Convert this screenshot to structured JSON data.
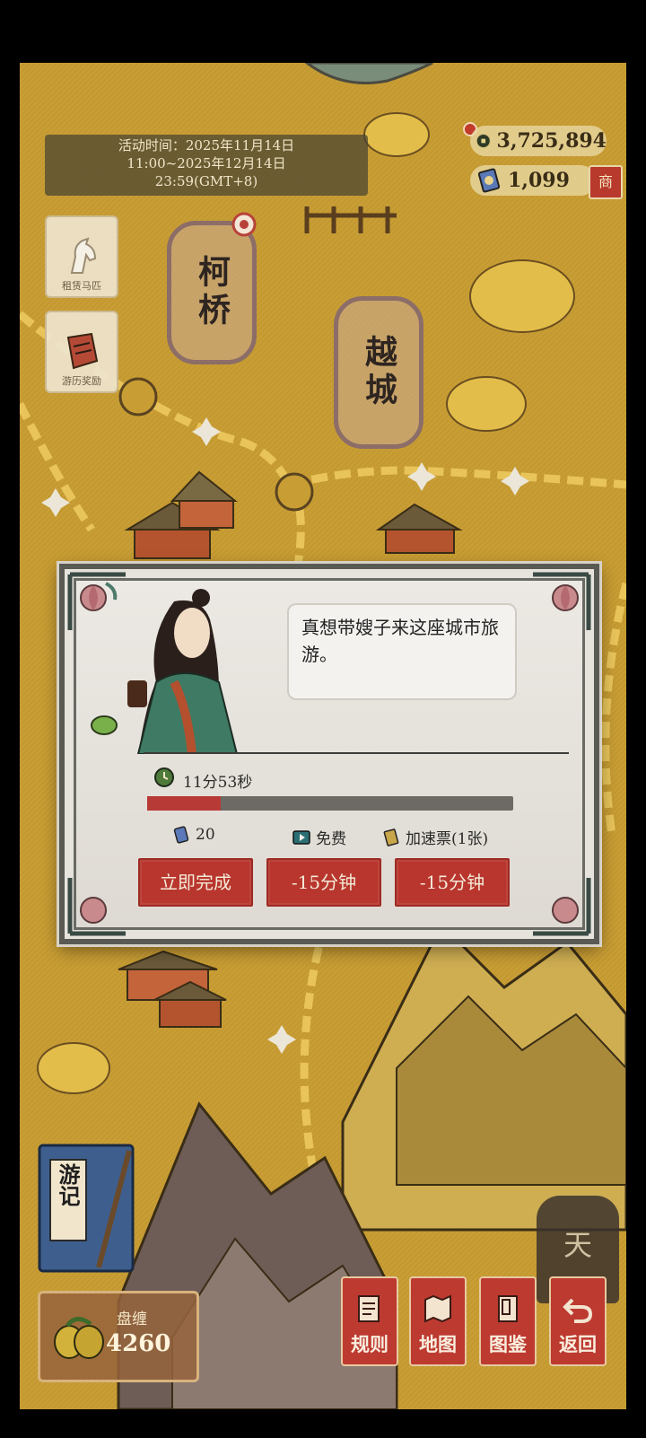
{
  "event": {
    "line1": "活动时间：2025年11月14日",
    "line2": "11:00~2025年12月14日",
    "line3": "23:59(GMT+8)"
  },
  "currency": {
    "coins": "3,725,894",
    "tickets": "1,099",
    "coin_icon": "copper-coin-icon",
    "ticket_icon": "ticket-icon",
    "shop_label": "商"
  },
  "side_buttons": [
    {
      "label": "租赁马匹",
      "icon": "horse-icon"
    },
    {
      "label": "游历奖励",
      "icon": "reward-scroll-icon"
    }
  ],
  "cities": [
    {
      "name": "柯桥"
    },
    {
      "name": "越城"
    }
  ],
  "dialog": {
    "speech": "真想带嫂子来这座城市旅游。",
    "timer": "11分53秒",
    "progress": 0.2,
    "cost_instant": "20",
    "cost_ad": "免费",
    "cost_ticket": "加速票(1张)",
    "btn_complete": "立即完成",
    "btn_ad": "-15分钟",
    "btn_ticket": "-15分钟"
  },
  "journal": {
    "label": "游记"
  },
  "melon": {
    "label": "盘缠",
    "count": "4260"
  },
  "tian_label": "天",
  "nav": [
    {
      "label": "规则",
      "icon": "rules-scroll-icon"
    },
    {
      "label": "地图",
      "icon": "map-icon"
    },
    {
      "label": "图鉴",
      "icon": "book-icon"
    },
    {
      "label": "返回",
      "icon": "back-arrow-icon"
    }
  ],
  "colors": {
    "map_base": "#c89d34",
    "button_red": "#b8362e",
    "progress_red": "#b83a36"
  }
}
